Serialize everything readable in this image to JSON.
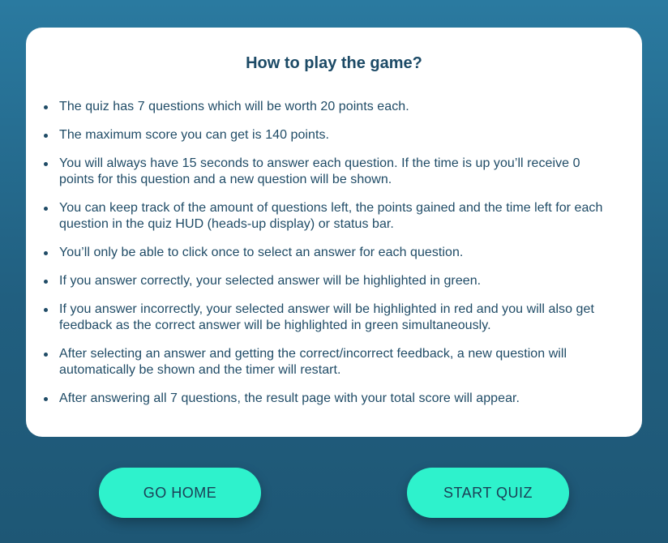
{
  "instructions": {
    "title": "How to play the game?",
    "rules": [
      "The quiz has 7 questions which will be worth 20 points each.",
      "The maximum score you can get is 140 points.",
      "You will always have 15 seconds to answer each question. If the time is up you’ll receive 0 points for this question and a new question will be shown.",
      "You can keep track of the amount of questions left, the points gained and the time left for each question in the quiz HUD (heads-up display) or status bar.",
      "You’ll only be able to click once to select an answer for each question.",
      "If you answer correctly, your selected answer will be highlighted in green.",
      "If you answer incorrectly, your selected answer will be highlighted in red and you will also get feedback as the correct answer will be highlighted in green simultaneously.",
      "After selecting an answer and getting the correct/incorrect feedback, a new question will automatically be shown and the timer will restart.",
      "After answering all 7 questions, the result page with your total score will appear."
    ]
  },
  "buttons": {
    "home_label": "GO HOME",
    "start_label": "START QUIZ"
  },
  "colors": {
    "background_top": "#2a7aa0",
    "background_bottom": "#1e5775",
    "card": "#ffffff",
    "title_text": "#1c4a66",
    "body_text": "#1f4b66",
    "button_accent": "#2ef2cc",
    "button_text": "#1b3f56"
  }
}
